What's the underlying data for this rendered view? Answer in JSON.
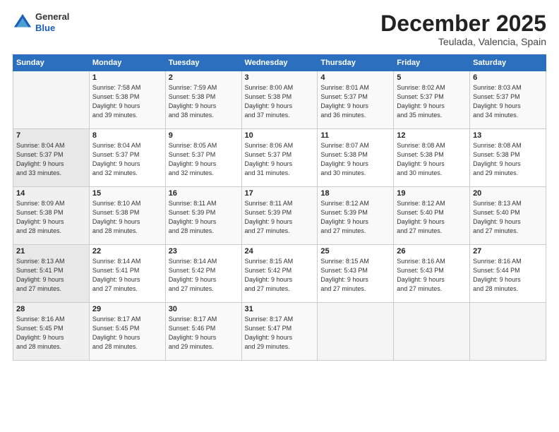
{
  "header": {
    "logo_line1": "General",
    "logo_line2": "Blue",
    "month": "December 2025",
    "location": "Teulada, Valencia, Spain"
  },
  "weekdays": [
    "Sunday",
    "Monday",
    "Tuesday",
    "Wednesday",
    "Thursday",
    "Friday",
    "Saturday"
  ],
  "weeks": [
    [
      {
        "day": "",
        "info": ""
      },
      {
        "day": "1",
        "info": "Sunrise: 7:58 AM\nSunset: 5:38 PM\nDaylight: 9 hours\nand 39 minutes."
      },
      {
        "day": "2",
        "info": "Sunrise: 7:59 AM\nSunset: 5:38 PM\nDaylight: 9 hours\nand 38 minutes."
      },
      {
        "day": "3",
        "info": "Sunrise: 8:00 AM\nSunset: 5:38 PM\nDaylight: 9 hours\nand 37 minutes."
      },
      {
        "day": "4",
        "info": "Sunrise: 8:01 AM\nSunset: 5:37 PM\nDaylight: 9 hours\nand 36 minutes."
      },
      {
        "day": "5",
        "info": "Sunrise: 8:02 AM\nSunset: 5:37 PM\nDaylight: 9 hours\nand 35 minutes."
      },
      {
        "day": "6",
        "info": "Sunrise: 8:03 AM\nSunset: 5:37 PM\nDaylight: 9 hours\nand 34 minutes."
      }
    ],
    [
      {
        "day": "7",
        "info": "Sunrise: 8:04 AM\nSunset: 5:37 PM\nDaylight: 9 hours\nand 33 minutes."
      },
      {
        "day": "8",
        "info": "Sunrise: 8:04 AM\nSunset: 5:37 PM\nDaylight: 9 hours\nand 32 minutes."
      },
      {
        "day": "9",
        "info": "Sunrise: 8:05 AM\nSunset: 5:37 PM\nDaylight: 9 hours\nand 32 minutes."
      },
      {
        "day": "10",
        "info": "Sunrise: 8:06 AM\nSunset: 5:37 PM\nDaylight: 9 hours\nand 31 minutes."
      },
      {
        "day": "11",
        "info": "Sunrise: 8:07 AM\nSunset: 5:38 PM\nDaylight: 9 hours\nand 30 minutes."
      },
      {
        "day": "12",
        "info": "Sunrise: 8:08 AM\nSunset: 5:38 PM\nDaylight: 9 hours\nand 30 minutes."
      },
      {
        "day": "13",
        "info": "Sunrise: 8:08 AM\nSunset: 5:38 PM\nDaylight: 9 hours\nand 29 minutes."
      }
    ],
    [
      {
        "day": "14",
        "info": "Sunrise: 8:09 AM\nSunset: 5:38 PM\nDaylight: 9 hours\nand 28 minutes."
      },
      {
        "day": "15",
        "info": "Sunrise: 8:10 AM\nSunset: 5:38 PM\nDaylight: 9 hours\nand 28 minutes."
      },
      {
        "day": "16",
        "info": "Sunrise: 8:11 AM\nSunset: 5:39 PM\nDaylight: 9 hours\nand 28 minutes."
      },
      {
        "day": "17",
        "info": "Sunrise: 8:11 AM\nSunset: 5:39 PM\nDaylight: 9 hours\nand 27 minutes."
      },
      {
        "day": "18",
        "info": "Sunrise: 8:12 AM\nSunset: 5:39 PM\nDaylight: 9 hours\nand 27 minutes."
      },
      {
        "day": "19",
        "info": "Sunrise: 8:12 AM\nSunset: 5:40 PM\nDaylight: 9 hours\nand 27 minutes."
      },
      {
        "day": "20",
        "info": "Sunrise: 8:13 AM\nSunset: 5:40 PM\nDaylight: 9 hours\nand 27 minutes."
      }
    ],
    [
      {
        "day": "21",
        "info": "Sunrise: 8:13 AM\nSunset: 5:41 PM\nDaylight: 9 hours\nand 27 minutes."
      },
      {
        "day": "22",
        "info": "Sunrise: 8:14 AM\nSunset: 5:41 PM\nDaylight: 9 hours\nand 27 minutes."
      },
      {
        "day": "23",
        "info": "Sunrise: 8:14 AM\nSunset: 5:42 PM\nDaylight: 9 hours\nand 27 minutes."
      },
      {
        "day": "24",
        "info": "Sunrise: 8:15 AM\nSunset: 5:42 PM\nDaylight: 9 hours\nand 27 minutes."
      },
      {
        "day": "25",
        "info": "Sunrise: 8:15 AM\nSunset: 5:43 PM\nDaylight: 9 hours\nand 27 minutes."
      },
      {
        "day": "26",
        "info": "Sunrise: 8:16 AM\nSunset: 5:43 PM\nDaylight: 9 hours\nand 27 minutes."
      },
      {
        "day": "27",
        "info": "Sunrise: 8:16 AM\nSunset: 5:44 PM\nDaylight: 9 hours\nand 28 minutes."
      }
    ],
    [
      {
        "day": "28",
        "info": "Sunrise: 8:16 AM\nSunset: 5:45 PM\nDaylight: 9 hours\nand 28 minutes."
      },
      {
        "day": "29",
        "info": "Sunrise: 8:17 AM\nSunset: 5:45 PM\nDaylight: 9 hours\nand 28 minutes."
      },
      {
        "day": "30",
        "info": "Sunrise: 8:17 AM\nSunset: 5:46 PM\nDaylight: 9 hours\nand 29 minutes."
      },
      {
        "day": "31",
        "info": "Sunrise: 8:17 AM\nSunset: 5:47 PM\nDaylight: 9 hours\nand 29 minutes."
      },
      {
        "day": "",
        "info": ""
      },
      {
        "day": "",
        "info": ""
      },
      {
        "day": "",
        "info": ""
      }
    ]
  ]
}
